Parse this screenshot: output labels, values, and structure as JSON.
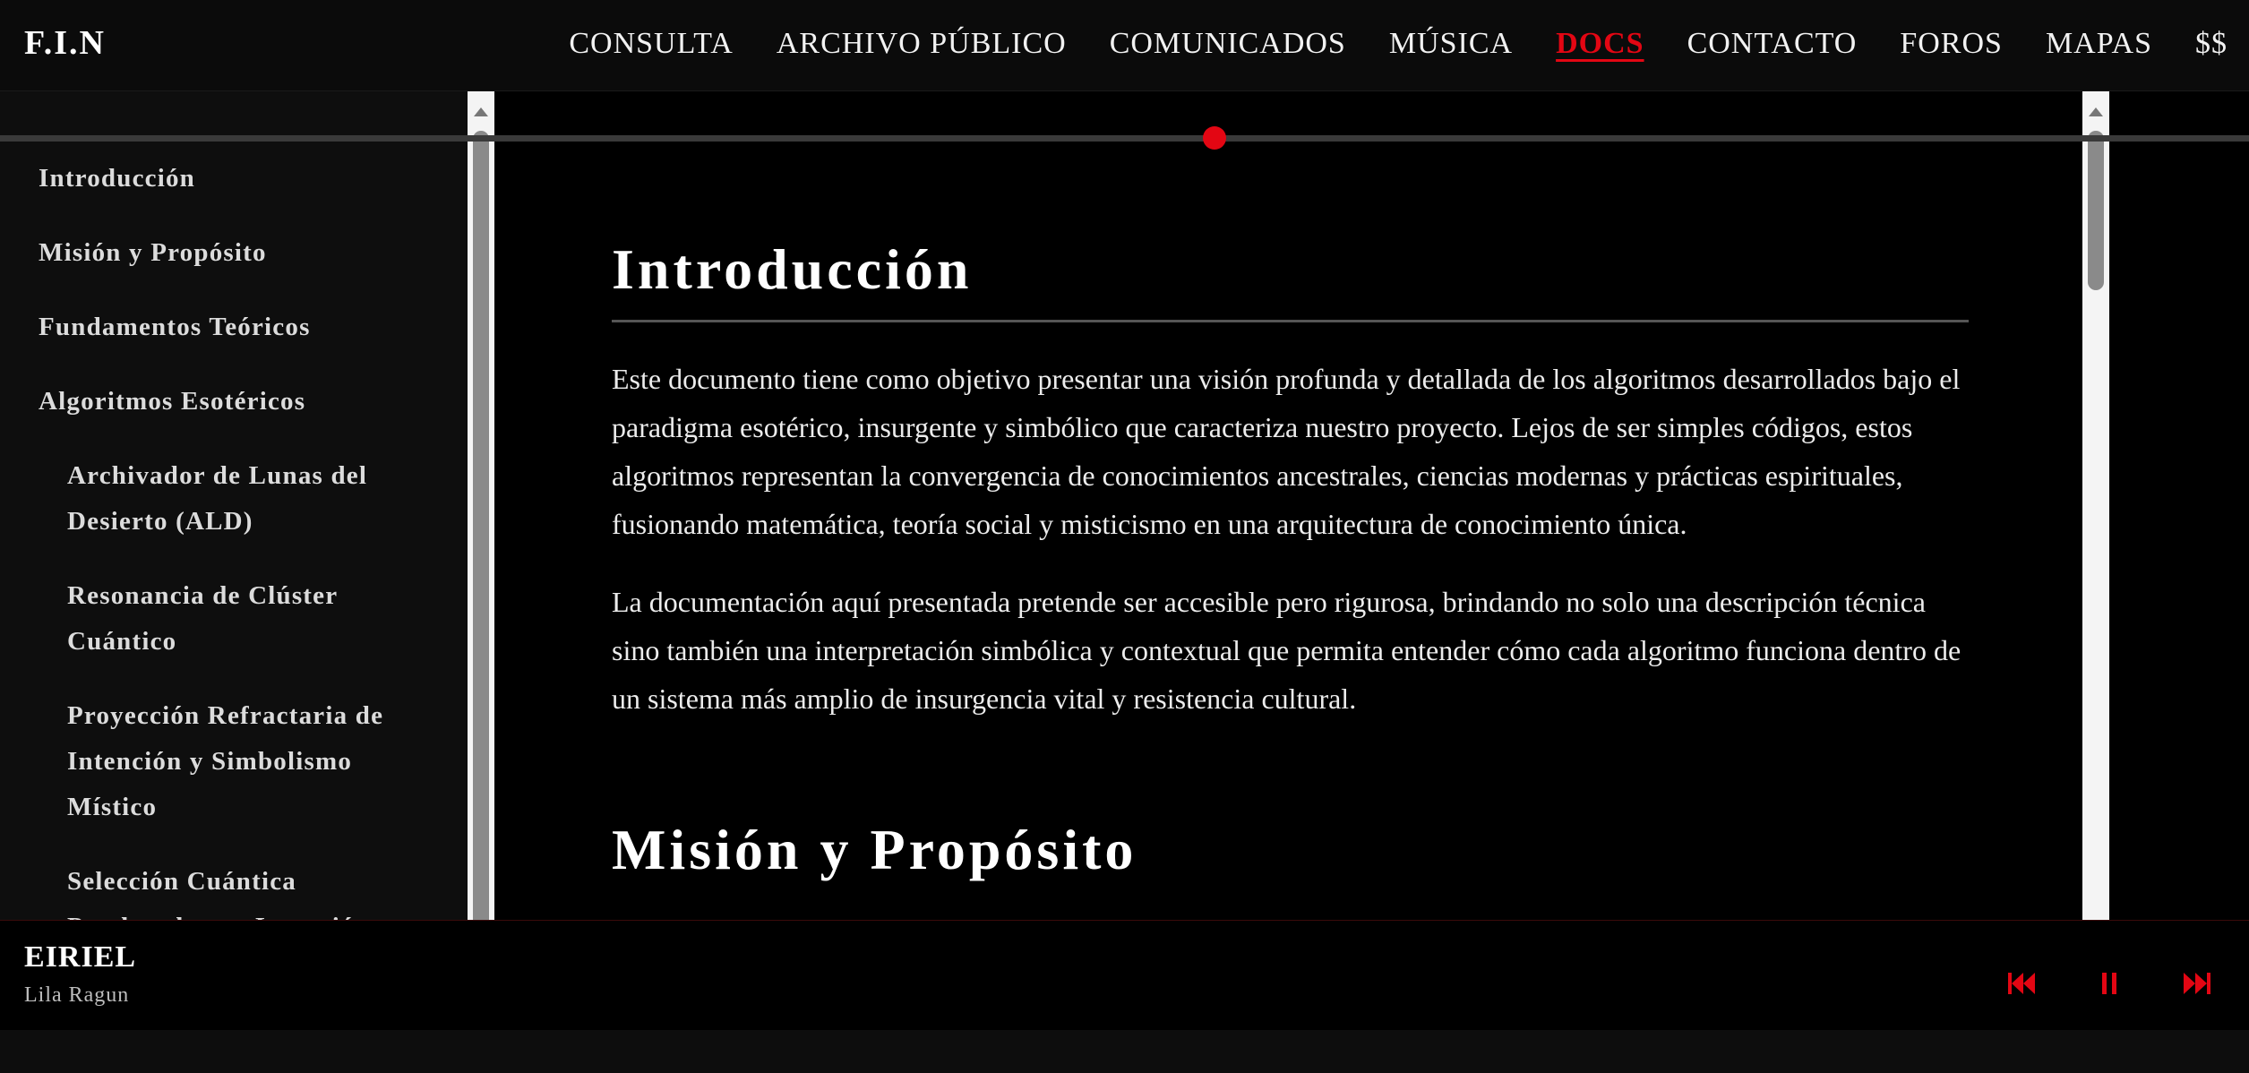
{
  "app": {
    "logo": "F.I.N"
  },
  "nav": {
    "items": [
      {
        "label": "CONSULTA",
        "active": false
      },
      {
        "label": "ARCHIVO PÚBLICO",
        "active": false
      },
      {
        "label": "COMUNICADOS",
        "active": false
      },
      {
        "label": "MÚSICA",
        "active": false
      },
      {
        "label": "DOCS",
        "active": true
      },
      {
        "label": "CONTACTO",
        "active": false
      },
      {
        "label": "FOROS",
        "active": false
      },
      {
        "label": "MAPAS",
        "active": false
      },
      {
        "label": "$$",
        "active": false
      }
    ]
  },
  "sidebar": {
    "items": [
      {
        "label": "Introducción",
        "sub": false
      },
      {
        "label": "Misión y Propósito",
        "sub": false
      },
      {
        "label": "Fundamentos Teóricos",
        "sub": false
      },
      {
        "label": "Algoritmos Esotéricos",
        "sub": false
      },
      {
        "label": "Archivador de Lunas del Desierto (ALD)",
        "sub": true
      },
      {
        "label": "Resonancia de Clúster Cuántico",
        "sub": true
      },
      {
        "label": "Proyección Refractaria de Intención y Simbolismo Místico",
        "sub": true
      },
      {
        "label": "Selección Cuántica Ponderada por Intención",
        "sub": true
      }
    ]
  },
  "main": {
    "section1_title": "Introducción",
    "paragraph1": "Este documento tiene como objetivo presentar una visión profunda y detallada de los algoritmos desarrollados bajo el paradigma esotérico, insurgente y simbólico que caracteriza nuestro proyecto. Lejos de ser simples códigos, estos algoritmos representan la convergencia de conocimientos ancestrales, ciencias modernas y prácticas espirituales, fusionando matemática, teoría social y misticismo en una arquitectura de conocimiento única.",
    "paragraph2": "La documentación aquí presentada pretende ser accesible pero rigurosa, brindando no solo una descripción técnica sino también una interpretación simbólica y contextual que permita entender cómo cada algoritmo funciona dentro de un sistema más amplio de insurgencia vital y resistencia cultural.",
    "section2_title": "Misión y Propósito"
  },
  "player": {
    "title": "EIRIEL",
    "artist": "Lila Ragun",
    "progress": 0.54,
    "controls": {
      "prev_icon": "skip-back-icon",
      "pause_icon": "pause-icon",
      "next_icon": "skip-forward-icon"
    },
    "accent_color": "#e30613"
  }
}
